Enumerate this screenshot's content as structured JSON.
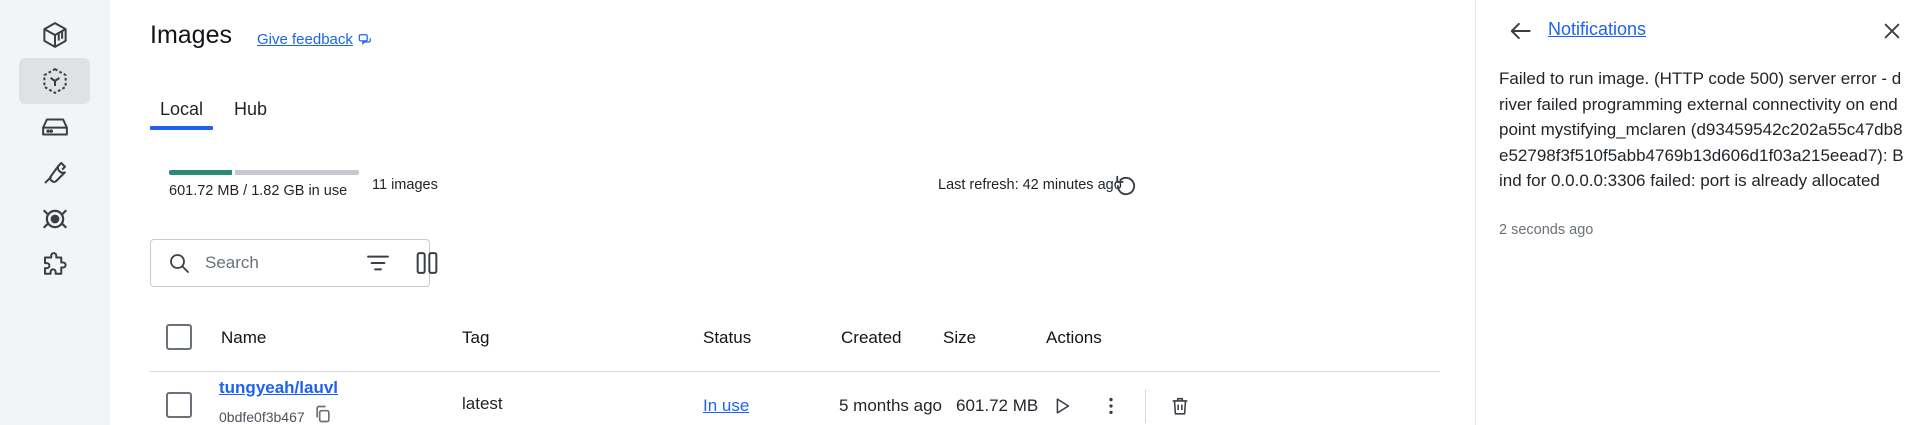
{
  "sidebar": {
    "items": [
      {
        "icon": "containers-icon"
      },
      {
        "icon": "images-icon",
        "active": true
      },
      {
        "icon": "volumes-icon"
      },
      {
        "icon": "builds-icon"
      },
      {
        "icon": "docker-scout-icon"
      },
      {
        "icon": "extensions-icon"
      }
    ]
  },
  "header": {
    "title": "Images",
    "feedback_label": "Give feedback"
  },
  "tabs": [
    {
      "label": "Local",
      "active": true
    },
    {
      "label": "Hub",
      "active": false
    }
  ],
  "usage": {
    "text": "601.72 MB / 1.82 GB in use",
    "fraction_used": 0.33,
    "image_count": "11 images"
  },
  "refresh": {
    "text": "Last refresh: 42 minutes ago"
  },
  "search": {
    "placeholder": "Search",
    "value": ""
  },
  "table": {
    "columns": [
      "Name",
      "Tag",
      "Status",
      "Created",
      "Size",
      "Actions"
    ],
    "rows": [
      {
        "name": "tungyeah/lauvl",
        "id": "0bdfe0f3b467",
        "tag": "latest",
        "status": "In use",
        "created": "5 months ago",
        "size": "601.72 MB"
      }
    ]
  },
  "notifications": {
    "title": "Notifications",
    "message": "Failed to run image. (HTTP code 500) server error - driver failed programming external connectivity on endpoint mystifying_mclaren (d93459542c202a55c47db8e52798f3f510f5abb4769b13d606d1f03a215eead7): Bind for 0.0.0.0:3306 failed: port is already allocated",
    "time": "2 seconds ago"
  },
  "colors": {
    "accent": "#1d63ed",
    "usage_bar": "#2b8a77",
    "sidebar_bg": "#f3f4f6"
  }
}
